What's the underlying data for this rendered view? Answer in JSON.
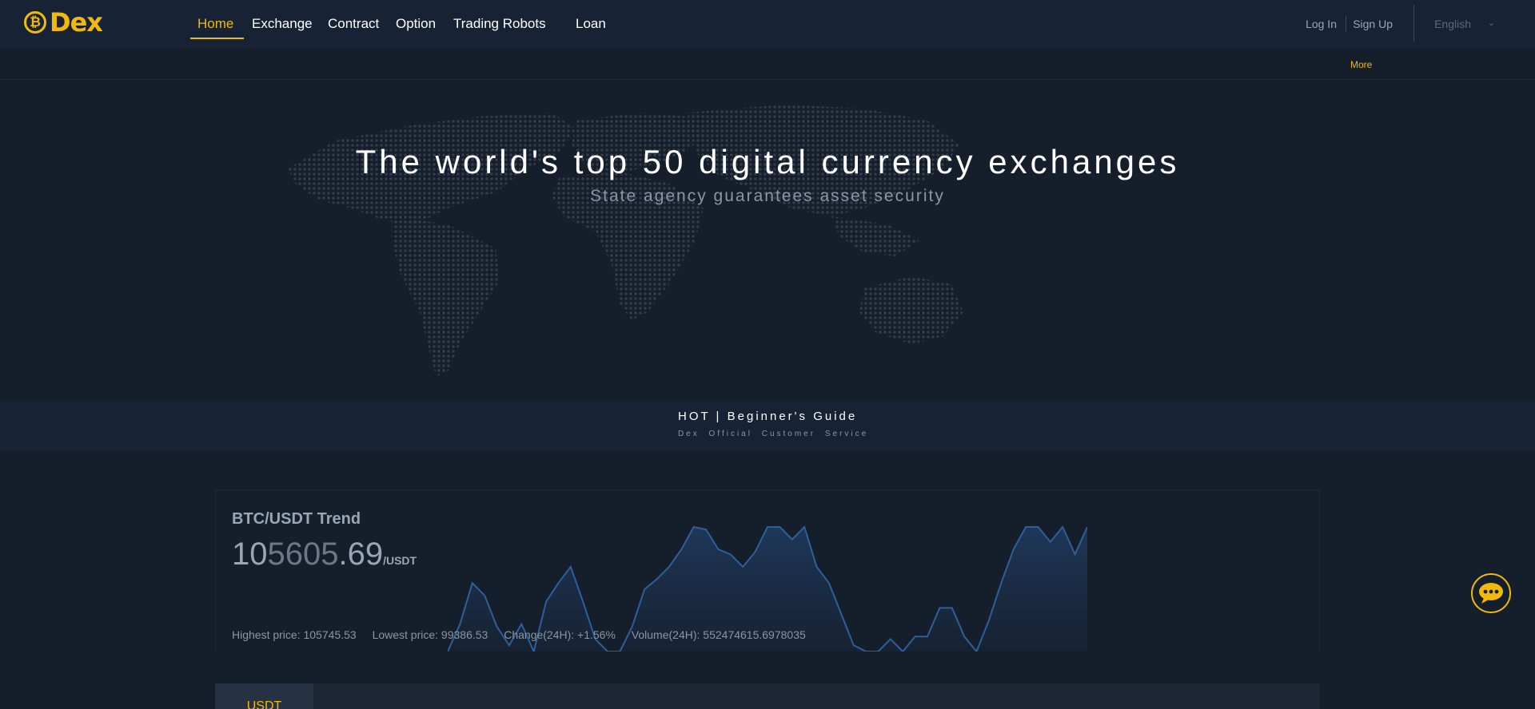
{
  "header": {
    "logo_text": "Dex",
    "logo_icon": "bitcoin-coin-icon",
    "nav": [
      {
        "label": "Home",
        "active": true
      },
      {
        "label": "Exchange"
      },
      {
        "label": "Contract"
      },
      {
        "label": "Option"
      },
      {
        "label": "Trading Robots"
      },
      {
        "label": "Loan"
      }
    ],
    "login": "Log In",
    "signup": "Sign Up",
    "language": "English"
  },
  "notice": {
    "more": "More"
  },
  "hero": {
    "title": "The world's top 50 digital currency exchanges",
    "subtitle": "State agency guarantees asset security"
  },
  "guide": {
    "title": "HOT | Beginner's Guide",
    "subtitle": "Dex Official Customer Service"
  },
  "trend": {
    "title": "BTC/USDT Trend",
    "price_bright_a": "10",
    "price_dim": "5605",
    "price_bright_b": ".69",
    "unit": "/USDT",
    "highest": "Highest price: 105745.53",
    "lowest": "Lowest price: 99386.53",
    "change": "Change(24H): +1.56%",
    "volume": "Volume(24H): 552474615.6978035"
  },
  "chart_data": {
    "type": "area",
    "values": [
      0,
      22,
      55,
      45,
      20,
      5,
      22,
      0,
      40,
      55,
      68,
      40,
      10,
      0,
      0,
      20,
      50,
      58,
      68,
      82,
      100,
      98,
      82,
      78,
      68,
      80,
      100,
      100,
      90,
      100,
      68,
      55,
      30,
      5,
      0,
      0,
      10,
      0,
      12,
      12,
      35,
      35,
      12,
      0,
      25,
      55,
      82,
      100,
      100,
      88,
      100,
      78,
      100
    ]
  },
  "markets": {
    "tabs": [
      "USDT"
    ]
  },
  "colors": {
    "accent": "#f0b90b",
    "background": "#151e2b",
    "header": "#172334",
    "chart_line": "#2f5f9a"
  },
  "chat_icon": "chat-bubble-icon"
}
